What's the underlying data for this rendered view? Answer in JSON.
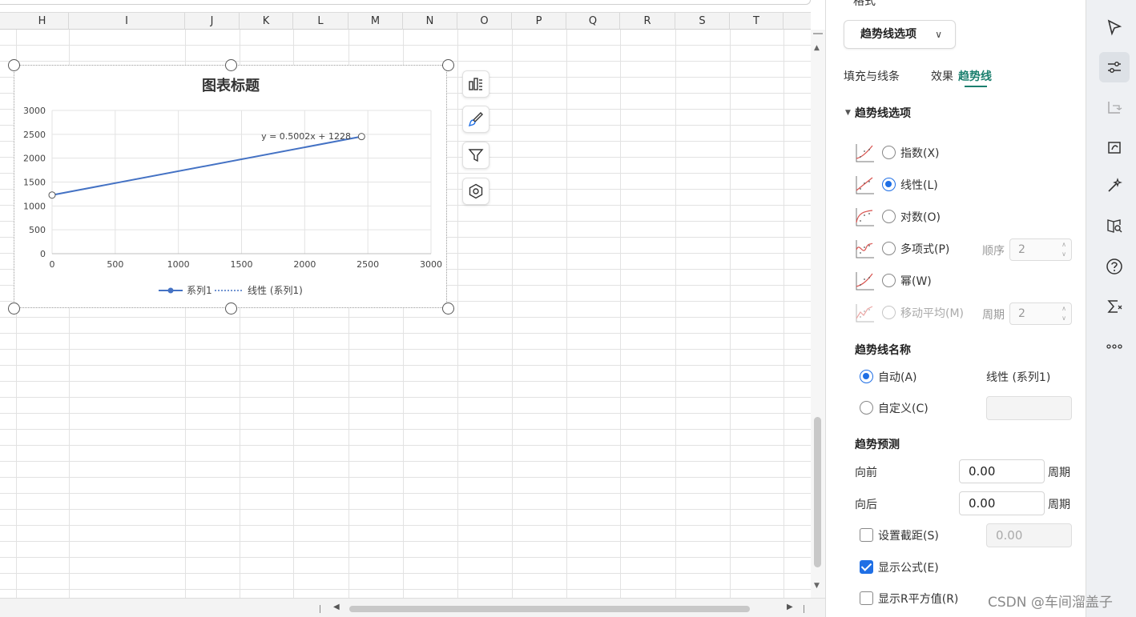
{
  "columns": [
    "H",
    "I",
    "J",
    "K",
    "L",
    "M",
    "N",
    "O",
    "P",
    "Q",
    "R",
    "S",
    "T"
  ],
  "chart_data": {
    "type": "scatter",
    "title": "图表标题",
    "xlim": [
      0,
      3000
    ],
    "ylim": [
      0,
      3000
    ],
    "x_ticks": [
      "0",
      "500",
      "1000",
      "1500",
      "2000",
      "2500",
      "3000"
    ],
    "y_ticks": [
      "0",
      "500",
      "1000",
      "1500",
      "2000",
      "2500",
      "3000"
    ],
    "series": [
      {
        "name": "系列1",
        "x": [
          0,
          2450
        ],
        "y": [
          1228,
          2453
        ],
        "style": "line-with-markers",
        "color": "#4472c4"
      }
    ],
    "trendline": {
      "legend": "线性 (系列1)",
      "equation": "y = 0.5002x + 1228",
      "style": "dotted"
    },
    "legend_position": "bottom",
    "grid": true
  },
  "pane": {
    "cut_title": "格式",
    "dropdown": "趋势线选项",
    "tabs": [
      "填充与线条",
      "效果",
      "趋势线"
    ],
    "active_tab": "趋势线",
    "trend_options_header": "趋势线选项",
    "options": [
      {
        "label": "指数(X)",
        "checked": false,
        "disabled": false
      },
      {
        "label": "线性(L)",
        "checked": true,
        "disabled": false
      },
      {
        "label": "对数(O)",
        "checked": false,
        "disabled": false
      },
      {
        "label": "多项式(P)",
        "checked": false,
        "disabled": false
      },
      {
        "label": "幂(W)",
        "checked": false,
        "disabled": false
      },
      {
        "label": "移动平均(M)",
        "checked": false,
        "disabled": true
      }
    ],
    "order_label": "顺序",
    "order_value": "2",
    "period_label": "周期",
    "period_value": "2",
    "name_header": "趋势线名称",
    "auto_label": "自动(A)",
    "auto_value": "线性 (系列1)",
    "custom_label": "自定义(C)",
    "forecast_header": "趋势预测",
    "forward_label": "向前",
    "forward_value": "0.00",
    "backward_label": "向后",
    "backward_value": "0.00",
    "period_unit": "周期",
    "intercept_label": "设置截距(S)",
    "intercept_value": "0.00",
    "show_equation_label": "显示公式(E)",
    "show_r2_label": "显示R平方值(R)"
  },
  "watermark": "CSDN @车间溜盖子",
  "colors": {
    "accent": "#1f6fe5",
    "active_tab": "#1b7f6e",
    "series": "#4472c4"
  }
}
